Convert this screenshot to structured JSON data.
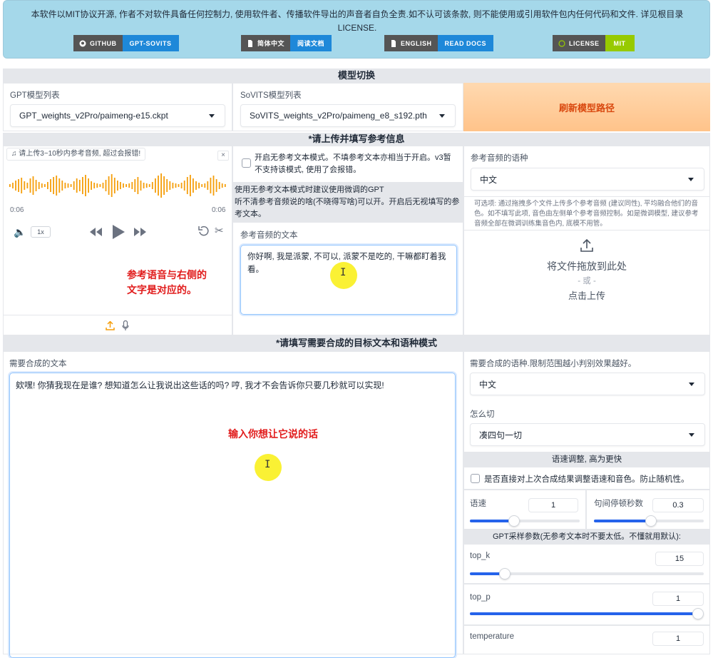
{
  "banner": {
    "text": "本软件以MIT协议开源, 作者不对软件具备任何控制力, 使用软件者、传播软件导出的声音者自负全责.如不认可该条款, 则不能使用或引用软件包内任何代码和文件. 详见根目录LICENSE.",
    "badges": [
      {
        "left": "GITHUB",
        "right": "GPT-SOVITS",
        "icon": "github-icon",
        "color": "#1e88d9"
      },
      {
        "left": "简体中文",
        "right": "阅读文档",
        "icon": "doc-icon",
        "color": "#1e88d9"
      },
      {
        "left": "ENGLISH",
        "right": "READ DOCS",
        "icon": "doc-icon",
        "color": "#1e88d9"
      },
      {
        "left": "LICENSE",
        "right": "MIT",
        "icon": "license-icon",
        "color": "#97ca00"
      }
    ]
  },
  "model_switch": {
    "header": "模型切换",
    "gpt_label": "GPT模型列表",
    "gpt_value": "GPT_weights_v2Pro/paimeng-e15.ckpt",
    "sovits_label": "SoVITS模型列表",
    "sovits_value": "SoVITS_weights_v2Pro/paimeng_e8_s192.pth",
    "refresh": "刷新模型路径"
  },
  "ref_section": {
    "header": "*请上传并填写参考信息",
    "audio": {
      "label": "请上传3~10秒内参考音频, 超过会报错!",
      "time_start": "0:06",
      "time_end": "0:06",
      "speed": "1x"
    },
    "annotation": "参考语音与右侧的\n文字是对应的。",
    "free_mode": {
      "label": "开启无参考文本模式。不填参考文本亦相当于开启。v3暂不支持该模式, 使用了会报错。",
      "hint": "使用无参考文本模式时建议使用微调的GPT\n听不清参考音频说的啥(不晓得写啥)可以开。开启后无视填写的参考文本。"
    },
    "ref_text_label": "参考音频的文本",
    "ref_text": "你好啊, 我是派蒙, 不可以, 派蒙不是吃的, 干嘛都盯着我看。",
    "ref_lang_label": "参考音频的语种",
    "ref_lang": "中文",
    "optional_hint": "可选项: 通过拖拽多个文件上传多个参考音频 (建议同性), 平均融合他们的音色。如不填写此项, 音色由左侧单个参考音频控制。如是微调模型, 建议参考音频全部在微调训练集音色内, 底模不用管。",
    "upload": {
      "drop": "将文件拖放到此处",
      "or": "- 或 -",
      "click": "点击上传"
    }
  },
  "target_section": {
    "header": "*请填写需要合成的目标文本和语种模式",
    "text_label": "需要合成的文本",
    "text": "欸嘿! 你猜我现在是谁? 想知道怎么让我说出这些话的吗? 哼, 我才不会告诉你只要几秒就可以实现!",
    "annotation": "输入你想让它说的话",
    "lang_label": "需要合成的语种.限制范围越小判别效果越好。",
    "lang": "中文",
    "cut_label": "怎么切",
    "cut": "凑四句一切",
    "speed_header": "语速调整, 高为更快",
    "keep_label": "是否直接对上次合成结果调整语速和音色。防止随机性。",
    "speed_label": "语速",
    "speed_value": "1",
    "pause_label": "句间停顿秒数",
    "pause_value": "0.3",
    "gpt_header": "GPT采样参数(无参考文本时不要太低。不懂就用默认):",
    "top_k_label": "top_k",
    "top_k": "15",
    "top_k_frac": 0.15,
    "top_p_label": "top_p",
    "top_p": "1",
    "top_p_frac": 1.0,
    "temp_label": "temperature",
    "temp": "1"
  }
}
